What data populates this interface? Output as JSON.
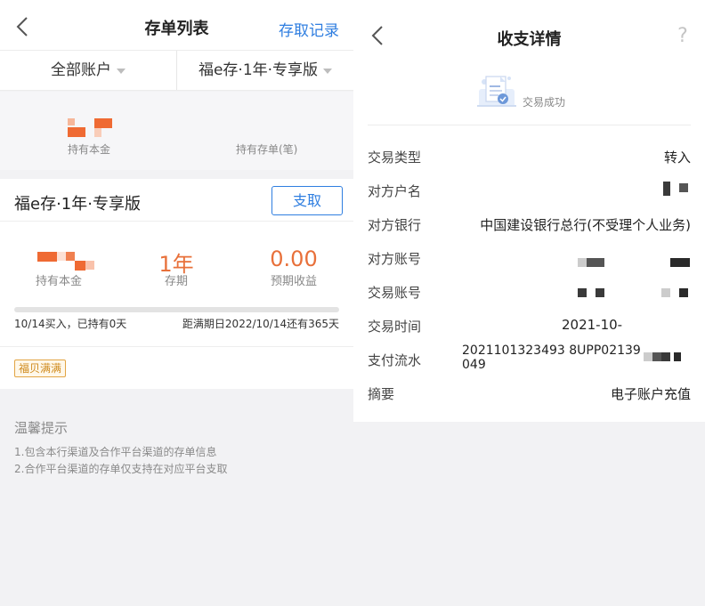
{
  "left": {
    "nav": {
      "back_icon": "chevron-left-icon",
      "title": "存单列表",
      "records_link": "存取记录"
    },
    "filter": {
      "account": "全部账户",
      "product": "福e存·1年·专享版"
    },
    "summary": {
      "principal_label": "持有本金",
      "deposits_label": "持有存单(笔)"
    },
    "card": {
      "product_name": "福e存·1年·专享版",
      "withdraw_button": "支取",
      "principal_label": "持有本金",
      "term_value": "1年",
      "term_label": "存期",
      "expected_value": "0.00",
      "expected_label": "预期收益",
      "progress_percent": 0,
      "bought_text": "10/14买入，已持有0天",
      "due_text": "距满期日2022/10/14还有365天",
      "tag": "福贝满满"
    },
    "tips": {
      "title": "温馨提示",
      "lines": [
        "1.包含本行渠道及合作平台渠道的存单信息",
        "2.合作平台渠道的存单仅支持在对应平台支取"
      ]
    }
  },
  "right": {
    "nav": {
      "back_icon": "chevron-left-icon",
      "title": "收支详情",
      "help_icon": "help-icon",
      "help_glyph": "?"
    },
    "status": {
      "icon": "document-success-icon",
      "text": "交易成功"
    },
    "rows": {
      "type": {
        "label": "交易类型",
        "value": "转入"
      },
      "counterparty_name": {
        "label": "对方户名"
      },
      "counterparty_bank": {
        "label": "对方银行",
        "value": "中国建设银行总行(不受理个人业务)"
      },
      "counterparty_account": {
        "label": "对方账号"
      },
      "account": {
        "label": "交易账号"
      },
      "time": {
        "label": "交易时间",
        "value": "2021-10-"
      },
      "serial": {
        "label": "支付流水",
        "value": "2021101323493 8UPP02139049"
      },
      "memo": {
        "label": "摘要",
        "value": "电子账户充值"
      }
    }
  },
  "colors": {
    "accent": "#2f7ee0",
    "orange": "#e8703a",
    "tag": "#cf8a1d"
  }
}
